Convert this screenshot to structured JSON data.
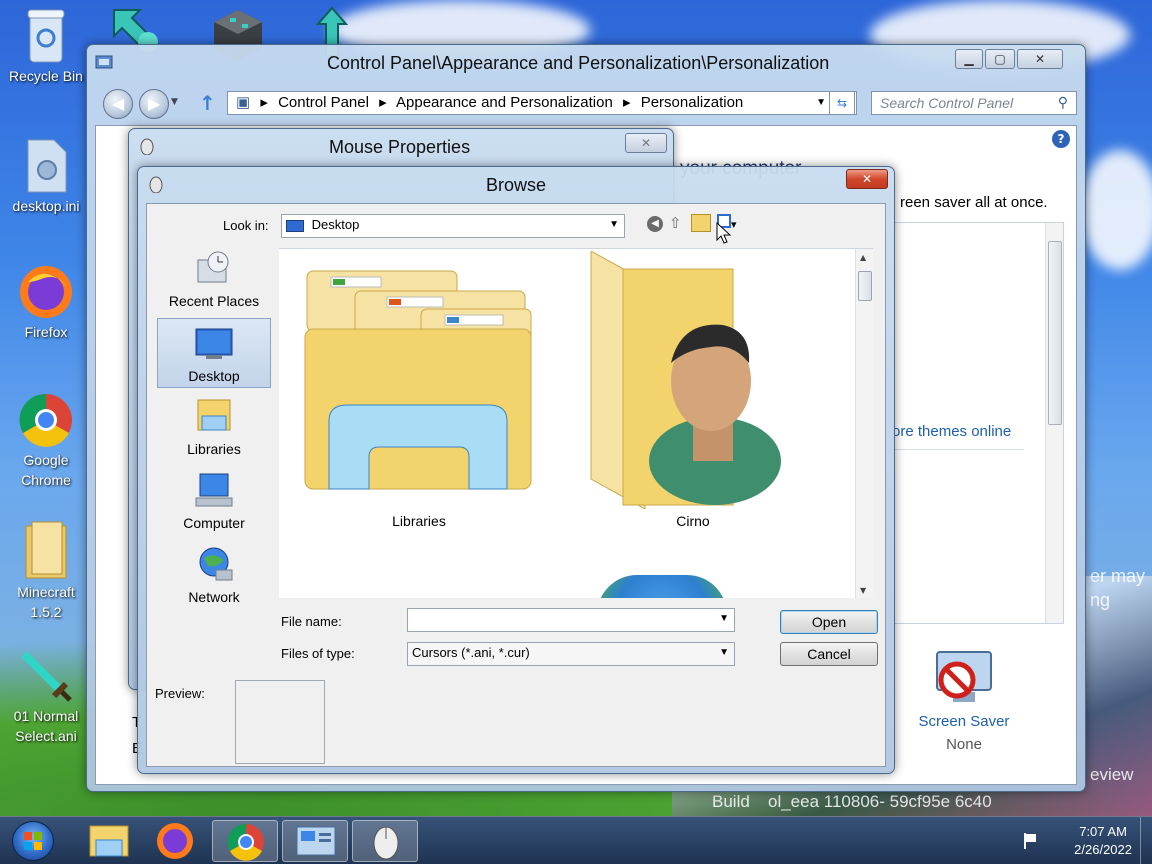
{
  "desktop": {
    "icons": [
      {
        "label": "Recycle Bin"
      },
      {
        "label": "desktop.ini"
      },
      {
        "label": "Firefox"
      },
      {
        "label": "Google Chrome"
      },
      {
        "label": "Minecraft 1.5.2"
      },
      {
        "label": "01 Normal Select.ani"
      }
    ],
    "watermark_line1": "eview",
    "watermark_line2": "Build",
    "watermark_build": "ol_eea 110806- 59cf95e 6c40",
    "side_text1": "er may",
    "side_text2": "ng"
  },
  "control_panel": {
    "title": "Control Panel\\Appearance and Personalization\\Personalization",
    "breadcrumb": [
      "Control Panel",
      "Appearance and Personalization",
      "Personalization"
    ],
    "search_placeholder": "Search Control Panel",
    "heading_fragment": "your computer",
    "desc_fragment": "reen saver all at once.",
    "link_fragment": "ore themes online",
    "screen_saver_label": "Screen Saver",
    "screen_saver_value": "None",
    "left_fragments": [
      "T",
      "E"
    ]
  },
  "mouse_properties": {
    "title": "Mouse Properties"
  },
  "browse": {
    "title": "Browse",
    "look_in_label": "Look in:",
    "look_in_value": "Desktop",
    "places": [
      {
        "label": "Recent Places"
      },
      {
        "label": "Desktop"
      },
      {
        "label": "Libraries"
      },
      {
        "label": "Computer"
      },
      {
        "label": "Network"
      }
    ],
    "items": [
      {
        "label": "Libraries"
      },
      {
        "label": "Cirno"
      }
    ],
    "file_name_label": "File name:",
    "file_name_value": "",
    "files_of_type_label": "Files of type:",
    "files_of_type_value": "Cursors (*.ani, *.cur)",
    "open_label": "Open",
    "cancel_label": "Cancel",
    "preview_label": "Preview:"
  },
  "taskbar": {
    "time": "7:07 AM",
    "date": "2/26/2022"
  }
}
